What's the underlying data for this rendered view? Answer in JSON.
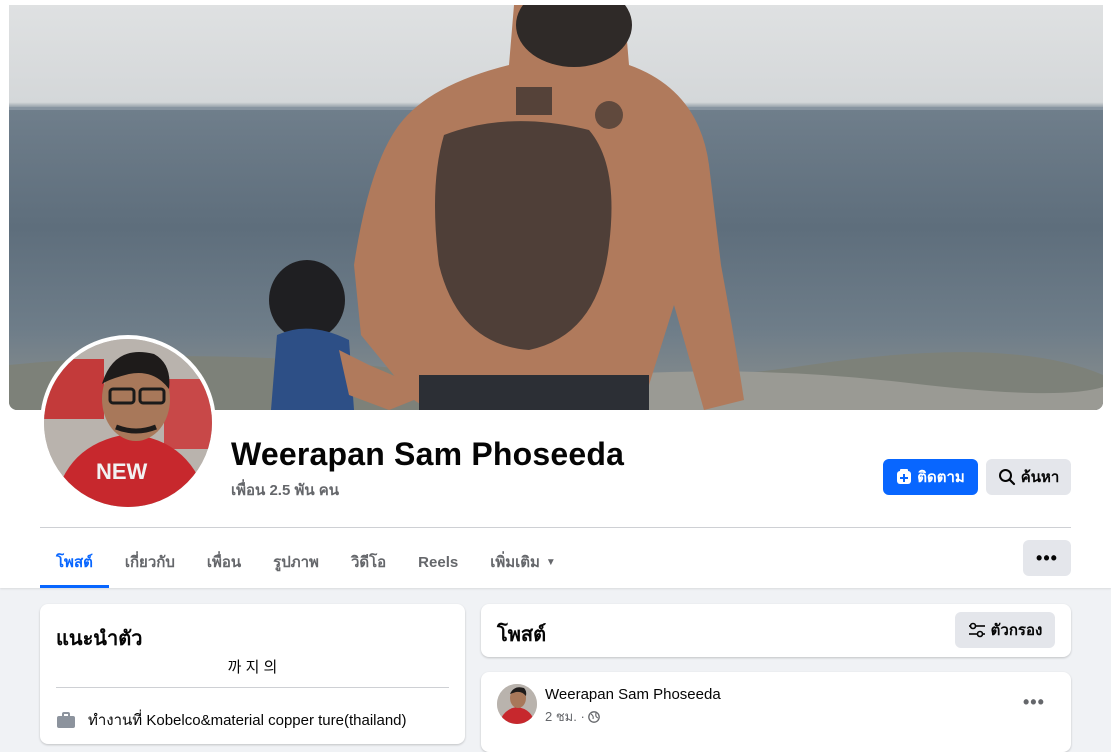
{
  "profile": {
    "name": "Weerapan Sam Phoseeda",
    "friends": "เพื่อน 2.5 พัน คน",
    "follow_label": "ติดตาม",
    "search_label": "ค้นหา",
    "more_label": "•••"
  },
  "tabs": [
    {
      "label": "โพสต์",
      "active": true
    },
    {
      "label": "เกี่ยวกับ"
    },
    {
      "label": "เพื่อน"
    },
    {
      "label": "รูปภาพ"
    },
    {
      "label": "วิดีโอ"
    },
    {
      "label": "Reels"
    },
    {
      "label": "เพิ่มเติม",
      "caret": "▼"
    }
  ],
  "intro": {
    "title": "แนะนำตัว",
    "bio": "까 지 의",
    "work": "ทำงานที่ Kobelco&material copper ture(thailand)"
  },
  "posts": {
    "title": "โพสต์",
    "filter_label": "ตัวกรอง",
    "first_post": {
      "author": "Weerapan Sam Phoseeda",
      "time": "2 ชม. ·",
      "more": "•••"
    }
  },
  "colors": {
    "accent": "#0866ff",
    "background": "#f0f2f5",
    "secondary_text": "#65676b"
  },
  "icons": {
    "follow": "follow-plus-icon",
    "search": "search-icon",
    "filter": "filter-sliders-icon",
    "work": "briefcase-icon",
    "audience": "globe-icon"
  }
}
